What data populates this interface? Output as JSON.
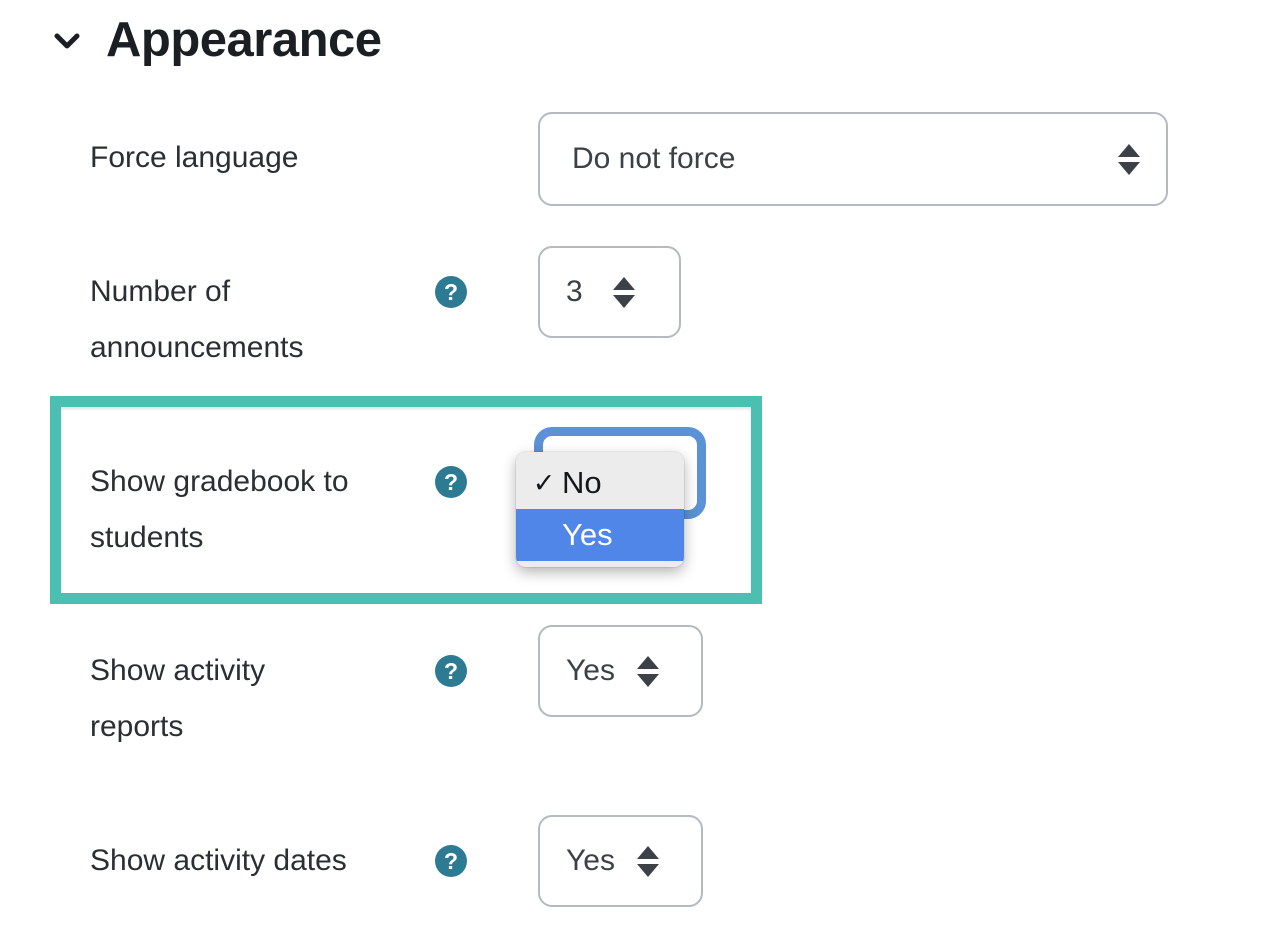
{
  "section": {
    "title": "Appearance",
    "toggle_icon": "chevron-down-icon",
    "expanded": true
  },
  "help_icon_glyph": "?",
  "colors": {
    "highlight_border": "#4bbfb2",
    "help_icon_bg": "#2d7b92",
    "focus_ring": "#5b92d6",
    "menu_selected_bg": "#4f86e8",
    "menu_bg": "#ececec",
    "page_bg": "#ffffff"
  },
  "rows": [
    {
      "id": "force-language",
      "label_lines": [
        "Force language"
      ],
      "has_help": false,
      "control": {
        "type": "select",
        "value": "Do not force",
        "size": "wide"
      }
    },
    {
      "id": "number-of-announcements",
      "label_lines": [
        "Number of",
        "announcements"
      ],
      "has_help": true,
      "control": {
        "type": "number",
        "value": "3",
        "size": "numeric"
      }
    },
    {
      "id": "show-gradebook-to-students",
      "label_lines": [
        "Show gradebook to",
        "students"
      ],
      "has_help": true,
      "highlighted": true,
      "control": {
        "type": "select-open",
        "value": "No",
        "options": [
          {
            "label": "No",
            "checked": true,
            "highlighted": false
          },
          {
            "label": "Yes",
            "checked": false,
            "highlighted": true
          }
        ],
        "checkmark": "✓"
      }
    },
    {
      "id": "show-activity-reports",
      "label_lines": [
        "Show activity",
        "reports"
      ],
      "has_help": true,
      "control": {
        "type": "select",
        "value": "Yes",
        "size": "small"
      }
    },
    {
      "id": "show-activity-dates",
      "label_lines": [
        "Show activity dates"
      ],
      "has_help": true,
      "control": {
        "type": "select",
        "value": "Yes",
        "size": "small"
      }
    }
  ]
}
